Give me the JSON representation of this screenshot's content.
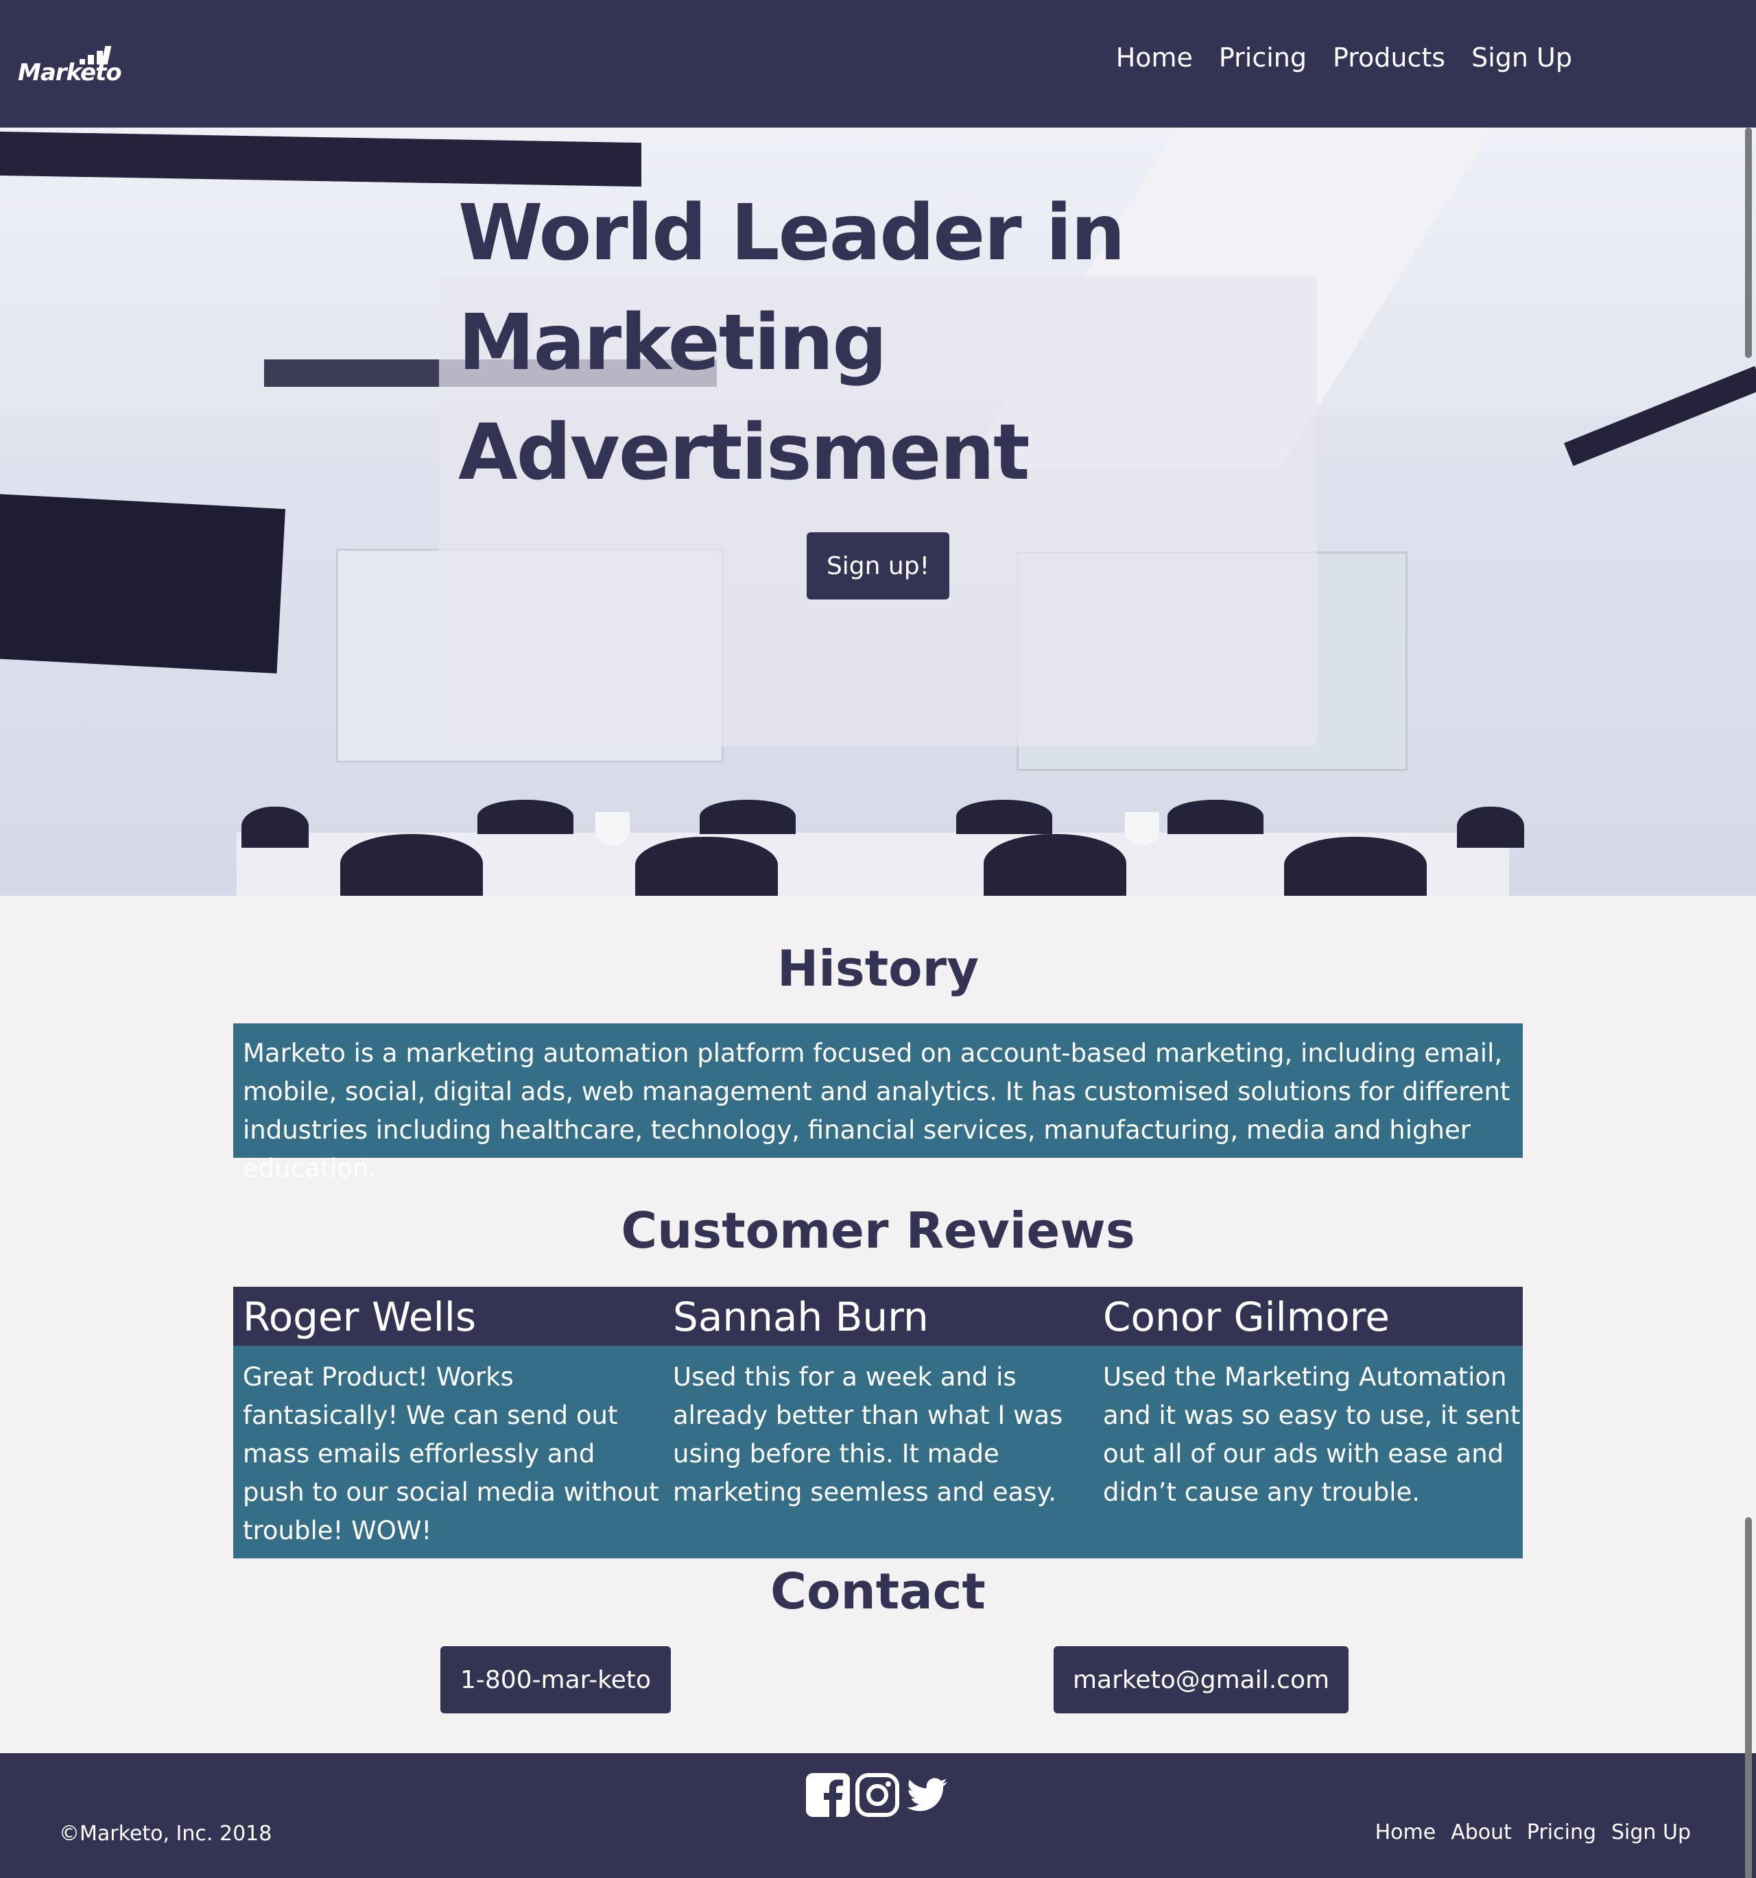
{
  "brand": {
    "name": "Marketo"
  },
  "nav": {
    "items": [
      "Home",
      "Pricing",
      "Products",
      "Sign Up"
    ]
  },
  "hero": {
    "title": "World Leader in Marketing Advertisment",
    "cta_label": "Sign up!"
  },
  "history": {
    "title": "History",
    "text": "Marketo is a marketing automation platform focused on account-based marketing, including email, mobile, social, digital ads, web management and analytics. It has customised solutions for different industries including healthcare, technology, financial services, manufacturing, media and higher education."
  },
  "reviews": {
    "title": "Customer Reviews",
    "items": [
      {
        "name": "Roger Wells",
        "text": "Great Product! Works fantasically! We can send out mass emails efforlessly and push to our social media without trouble! WOW!"
      },
      {
        "name": "Sannah Burn",
        "text": "Used this for a week and is already better than what I was using before this. It made marketing seemless and easy."
      },
      {
        "name": "Conor Gilmore",
        "text": "Used the Marketing Automation and it was so easy to use, it sent out all of our ads with ease and didn’t cause any trouble."
      }
    ]
  },
  "contact": {
    "title": "Contact",
    "phone": "1-800-mar-keto",
    "email": "marketo@gmail.com"
  },
  "footer": {
    "social_icons": [
      "facebook-icon",
      "instagram-icon",
      "twitter-icon"
    ],
    "copyright": "©Marketo, Inc. 2018",
    "links": [
      "Home",
      "About",
      "Pricing",
      "Sign Up"
    ]
  },
  "colors": {
    "primary": "#343353",
    "accent": "#346e87",
    "background": "#f3f1f2"
  }
}
